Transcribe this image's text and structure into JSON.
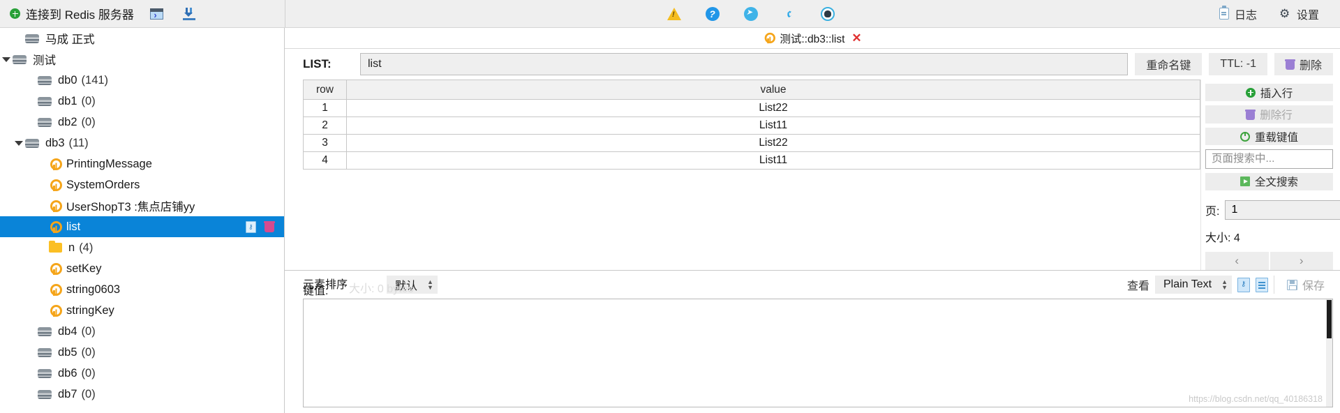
{
  "topbar": {
    "connect_label": "连接到 Redis 服务器",
    "console_icon": "console-icon",
    "import_icon": "import-icon",
    "social": [
      {
        "name": "warning-icon",
        "glyph": "!"
      },
      {
        "name": "help-icon",
        "glyph": "?"
      },
      {
        "name": "telegram-icon",
        "glyph": ""
      },
      {
        "name": "twitter-icon",
        "glyph": "ᵗ"
      },
      {
        "name": "github-icon",
        "glyph": ""
      }
    ],
    "logs_label": "日志",
    "settings_label": "设置"
  },
  "sidebar": {
    "items": [
      {
        "label": "马成 正式",
        "icon": "database-icon",
        "indent": 18,
        "twisty": "",
        "count": "",
        "selected": false
      },
      {
        "label": "测试",
        "icon": "database-icon",
        "indent": 0,
        "twisty": "open",
        "count": "",
        "selected": false
      },
      {
        "label": "db0",
        "icon": "database-icon",
        "indent": 36,
        "twisty": "",
        "count": "(141)",
        "selected": false
      },
      {
        "label": "db1",
        "icon": "database-icon",
        "indent": 36,
        "twisty": "",
        "count": "(0)",
        "selected": false
      },
      {
        "label": "db2",
        "icon": "database-icon",
        "indent": 36,
        "twisty": "",
        "count": "(0)",
        "selected": false
      },
      {
        "label": "db3",
        "icon": "database-icon",
        "indent": 18,
        "twisty": "open",
        "count": "(11)",
        "selected": false
      },
      {
        "label": "PrintingMessage",
        "icon": "key-icon",
        "indent": 52,
        "twisty": "",
        "count": "",
        "selected": false
      },
      {
        "label": "SystemOrders",
        "icon": "key-icon",
        "indent": 52,
        "twisty": "",
        "count": "",
        "selected": false
      },
      {
        "label": "UserShopT3 :焦点店铺yy",
        "icon": "key-icon",
        "indent": 52,
        "twisty": "",
        "count": "",
        "selected": false
      },
      {
        "label": "list",
        "icon": "key-icon",
        "indent": 52,
        "twisty": "",
        "count": "",
        "selected": true
      },
      {
        "label": "n",
        "icon": "folder-icon",
        "indent": 52,
        "twisty": "",
        "count": "(4)",
        "selected": false
      },
      {
        "label": "setKey",
        "icon": "key-icon",
        "indent": 52,
        "twisty": "",
        "count": "",
        "selected": false
      },
      {
        "label": "string0603",
        "icon": "key-icon",
        "indent": 52,
        "twisty": "",
        "count": "",
        "selected": false
      },
      {
        "label": "stringKey",
        "icon": "key-icon",
        "indent": 52,
        "twisty": "",
        "count": "",
        "selected": false
      },
      {
        "label": "db4",
        "icon": "database-icon",
        "indent": 36,
        "twisty": "",
        "count": "(0)",
        "selected": false
      },
      {
        "label": "db5",
        "icon": "database-icon",
        "indent": 36,
        "twisty": "",
        "count": "(0)",
        "selected": false
      },
      {
        "label": "db6",
        "icon": "database-icon",
        "indent": 36,
        "twisty": "",
        "count": "(0)",
        "selected": false
      },
      {
        "label": "db7",
        "icon": "database-icon",
        "indent": 36,
        "twisty": "",
        "count": "(0)",
        "selected": false
      }
    ],
    "selected_row_actions": {
      "edit": "edit-key-icon",
      "delete": "delete-key-icon"
    }
  },
  "tab": {
    "title": "测试::db3::list",
    "close": "✕"
  },
  "keyheader": {
    "type_label": "LIST:",
    "key_name": "list",
    "rename_label": "重命名键",
    "ttl_label": "TTL: -1",
    "delete_label": "删除"
  },
  "table": {
    "columns": [
      "row",
      "value"
    ],
    "rows": [
      {
        "row": "1",
        "value": "List22"
      },
      {
        "row": "2",
        "value": "List11"
      },
      {
        "row": "3",
        "value": "List22"
      },
      {
        "row": "4",
        "value": "List11"
      }
    ]
  },
  "rightpanel": {
    "insert_row": "插入行",
    "delete_row": "删除行",
    "reload_value": "重载键值",
    "search_placeholder": "页面搜索中...",
    "fulltext_search": "全文搜索",
    "page_label": "页:",
    "page_value": "1",
    "size_label": "大小: 4",
    "prev": "‹",
    "next": "›"
  },
  "editor": {
    "sort_label": "元素排序",
    "value_label": "键值:",
    "sort_value": "默认",
    "ghost_size": "大小: 0 bytes",
    "view_label": "查看",
    "view_value": "Plain Text",
    "save_label": "保存",
    "text_value": "",
    "watermark": "https://blog.csdn.net/qq_40186318"
  }
}
